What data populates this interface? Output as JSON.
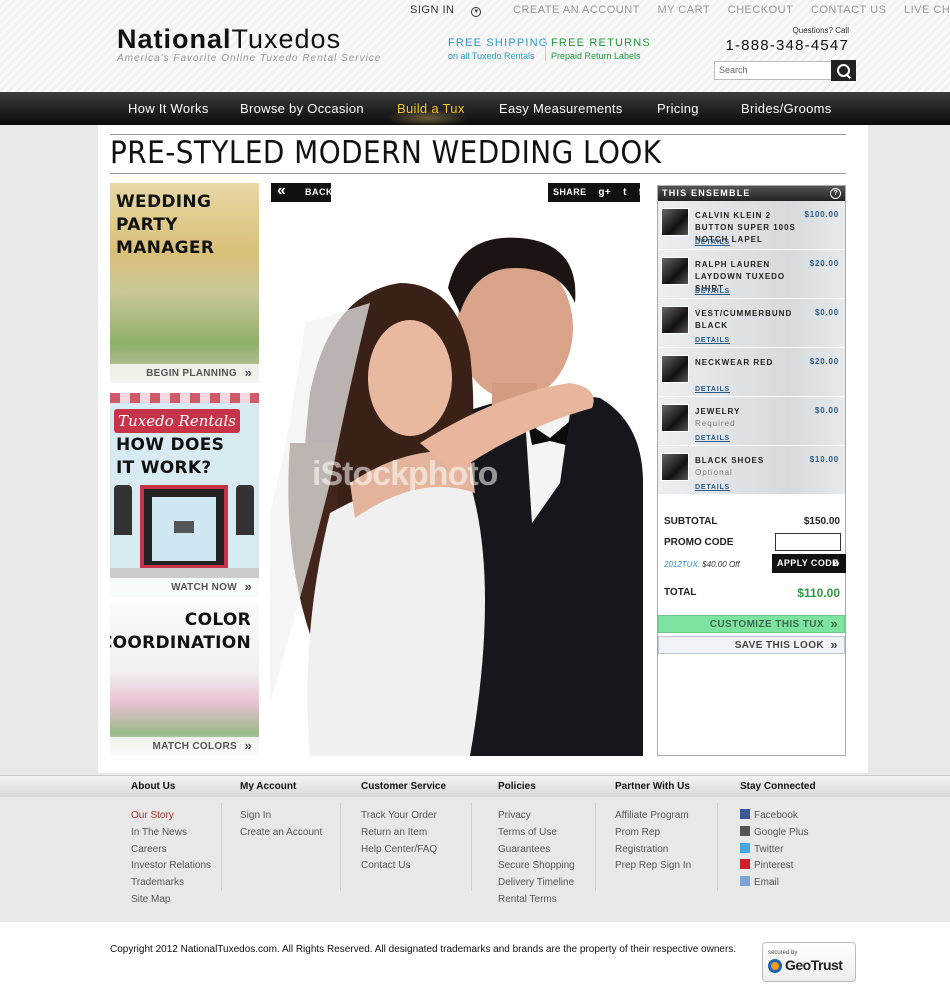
{
  "header": {
    "toplinks": {
      "sign_in": "SIGN IN",
      "create_account": "CREATE AN ACCOUNT",
      "my_cart": "MY CART",
      "checkout": "CHECKOUT",
      "contact_us": "CONTACT US",
      "live_chat": "LIVE CHAT"
    },
    "logo": {
      "bold": "National",
      "light": "Tuxedos",
      "tagline": "America's   Favorite Online Tuxedo Rental Service"
    },
    "promo_shipping": {
      "title": "FREE SHIPPING",
      "sub": "on all Tuxedo Rentals"
    },
    "promo_returns": {
      "title": "FREE RETURNS",
      "sub": "Prepaid Return Labels"
    },
    "questions": "Questions? Call",
    "phone": "1-888-348-4547",
    "search_placeholder": "Search"
  },
  "nav": {
    "items": [
      "How It Works",
      "Browse by Occasion",
      "Build a Tux",
      "Easy Measurements",
      "Pricing",
      "Brides/Grooms"
    ],
    "active": "Build a Tux"
  },
  "page_title": "PRE-STYLED MODERN WEDDING LOOK",
  "tiles": [
    {
      "heading_1": "WEDDING",
      "heading_2": "PARTY MANAGER",
      "cta": "BEGIN PLANNING"
    },
    {
      "banner": "Tuxedo Rentals",
      "heading_1": "HOW DOES",
      "heading_2": "IT WORK?",
      "cta": "WATCH NOW"
    },
    {
      "heading_1": "COLOR",
      "heading_2": "COORDINATION",
      "cta": "MATCH COLORS"
    }
  ],
  "photo": {
    "back_label": "BACK",
    "share_label": "SHARE",
    "share_icons": [
      "g+",
      "t",
      "f"
    ],
    "watermark": "iStockphoto"
  },
  "ensemble": {
    "title": "THIS ENSEMBLE",
    "help": "?",
    "details_label": "DETAILS",
    "items": [
      {
        "name": "CALVIN KLEIN 2 BUTTON SUPER 100S NOTCH LAPEL",
        "sub": "",
        "price": "$100.00"
      },
      {
        "name": "RALPH LAUREN LAYDOWN TUXEDO SHIRT",
        "sub": "",
        "price": "$20.00"
      },
      {
        "name": "VEST/CUMMERBUND BLACK",
        "sub": "",
        "price": "$0.00"
      },
      {
        "name": "NECKWEAR RED",
        "sub": "",
        "price": "$20.00"
      },
      {
        "name": "JEWELRY",
        "sub": "Required",
        "price": "$0.00"
      },
      {
        "name": "BLACK SHOES",
        "sub": "Optional",
        "price": "$10.00"
      }
    ],
    "subtotal_label": "SUBTOTAL",
    "subtotal": "$150.00",
    "promo_label": "PROMO CODE",
    "promo_value": "",
    "applied_code": "2012TUX:",
    "applied_off": " $40.00 Off",
    "apply_label": "APPLY CODE",
    "total_label": "TOTAL",
    "total": "$110.00",
    "customize_label": "CUSTOMIZE THIS TUX",
    "save_label": "SAVE THIS LOOK"
  },
  "footer": {
    "columns": [
      {
        "heading": "About Us",
        "links": [
          "Our Story",
          "In The News",
          "Careers",
          "Investor Relations",
          "Trademarks",
          "Site Map"
        ]
      },
      {
        "heading": "My Account",
        "links": [
          "Sign In",
          "Create an Account"
        ]
      },
      {
        "heading": "Customer Service",
        "links": [
          "Track Your Order",
          "Return an Item",
          "Help Center/FAQ",
          "Contact Us"
        ]
      },
      {
        "heading": "Policies",
        "links": [
          "Privacy",
          "Terms of Use",
          "Guarantees",
          "Secure Shopping",
          "Delivery Timeline",
          "Rental Terms"
        ]
      },
      {
        "heading": "Partner With Us",
        "links": [
          "Affiliate Program",
          "Prom Rep",
          "Registration",
          "Prep Rep Sign In"
        ]
      },
      {
        "heading": "Stay Connected",
        "links": [
          "Facebook",
          "Google Plus",
          "Twitter",
          "Pinterest",
          "Email"
        ]
      }
    ],
    "copyright": "Copyright 2012 NationalTuxedos.com.  All Rights Reserved.  All designated trademarks and brands are the property of their respective owners.",
    "badge_secured": "secured by",
    "badge_name": "GeoTrust"
  },
  "colors": {
    "nav_active": "#f3c21a",
    "total_green": "#2e9a3f",
    "price_blue": "#2d5c86",
    "customize_green": "#7fe3a0"
  }
}
